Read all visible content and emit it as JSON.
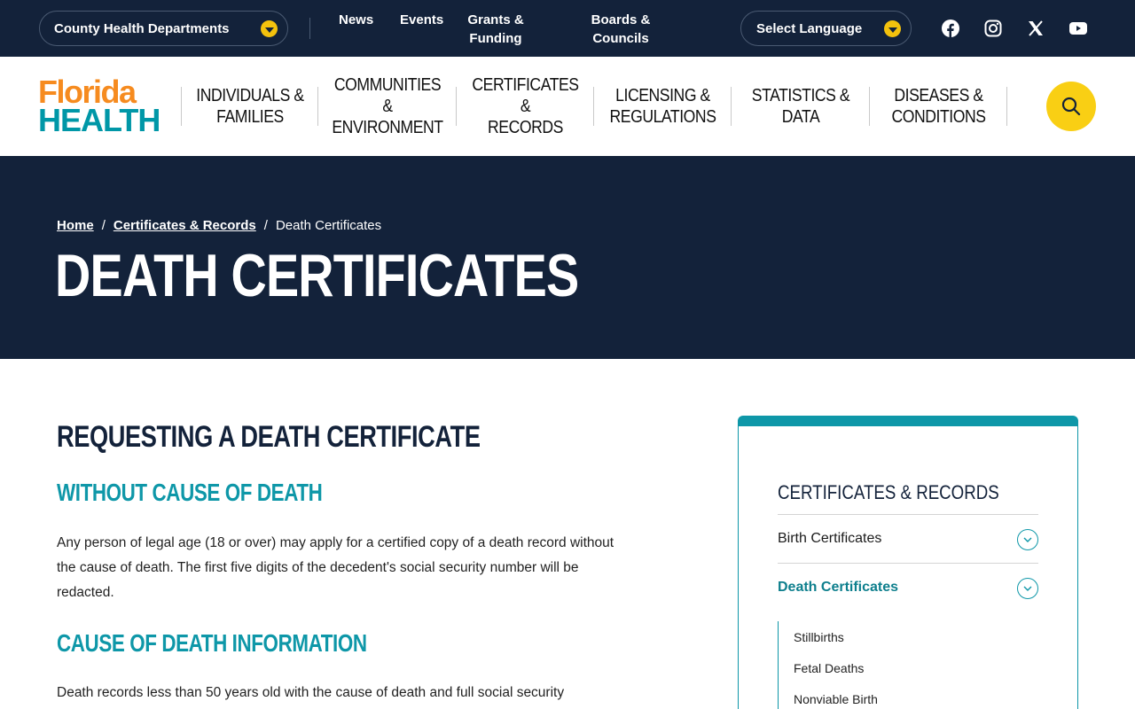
{
  "utility": {
    "county_label": "County Health Departments",
    "links": [
      "News",
      "Events",
      "Grants & Funding",
      "Boards & Councils"
    ],
    "language_label": "Select Language",
    "social_icons": [
      "facebook-icon",
      "instagram-icon",
      "x-icon",
      "youtube-icon"
    ]
  },
  "brand": {
    "logo_top": "Florida",
    "logo_bottom": "HEALTH",
    "colors": {
      "orange": "#f68b1f",
      "teal": "#0097a7",
      "navy": "#13223a",
      "yellow": "#f9cf14"
    }
  },
  "nav": {
    "items": [
      {
        "line1": "Individuals &",
        "line2": "Families"
      },
      {
        "line1": "Communities",
        "line2": "&",
        "line3": "Environment"
      },
      {
        "line1": "Certificates",
        "line2": "&",
        "line3": "Records"
      },
      {
        "line1": "Licensing &",
        "line2": "Regulations"
      },
      {
        "line1": "Statistics &",
        "line2": "Data"
      },
      {
        "line1": "Diseases &",
        "line2": "Conditions"
      }
    ]
  },
  "breadcrumb": {
    "home": "Home",
    "section": "Certificates & Records",
    "current": "Death Certificates",
    "sep": "/"
  },
  "page": {
    "title": "DEATH CERTIFICATES"
  },
  "content": {
    "heading": "REQUESTING A DEATH CERTIFICATE",
    "sub1": "WITHOUT CAUSE OF DEATH",
    "para1": "Any person of legal age (18 or over) may apply for a certified copy of a death record without the cause of death. The first five digits of the decedent's social security number will be redacted.",
    "sub2": "CAUSE OF DEATH INFORMATION",
    "para2": "Death records less than 50 years old with the cause of death and full social security"
  },
  "sidebar": {
    "title": "Certificates & Records",
    "rows": [
      "Birth Certificates",
      "Death Certificates"
    ],
    "sub_items": [
      "Stillbirths",
      "Fetal Deaths",
      "Nonviable Birth"
    ]
  }
}
